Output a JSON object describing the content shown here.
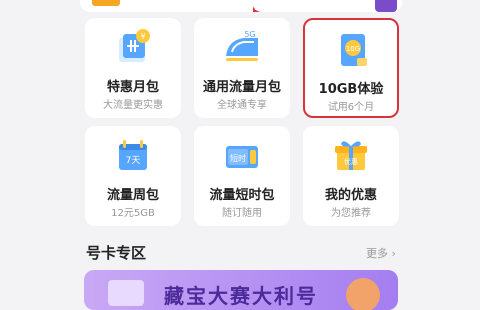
{
  "tiles": [
    {
      "title": "特惠月包",
      "subtitle": "大流量更实惠",
      "icon": "coin-wallet-icon"
    },
    {
      "title": "通用流量月包",
      "subtitle": "全球通专享",
      "icon": "5g-train-icon"
    },
    {
      "title": "10GB体验",
      "subtitle": "试用6个月",
      "icon": "10g-sim-card-icon",
      "badge": "10G"
    },
    {
      "title": "流量周包",
      "subtitle": "12元5GB",
      "icon": "calendar-7-days-icon",
      "badge": "7天"
    },
    {
      "title": "流量短时包",
      "subtitle": "随订随用",
      "icon": "short-time-ticket-icon",
      "badge": "短时"
    },
    {
      "title": "我的优惠",
      "subtitle": "为您推荐",
      "icon": "gift-box-icon",
      "badge": "优惠"
    }
  ],
  "section": {
    "title": "号卡专区",
    "more": "更多 ›"
  },
  "banner": {
    "text": "藏宝大赛大利号"
  },
  "colors": {
    "highlight": "#d9323d",
    "bg": "#f3f3f5",
    "accent": "#f5a623"
  }
}
